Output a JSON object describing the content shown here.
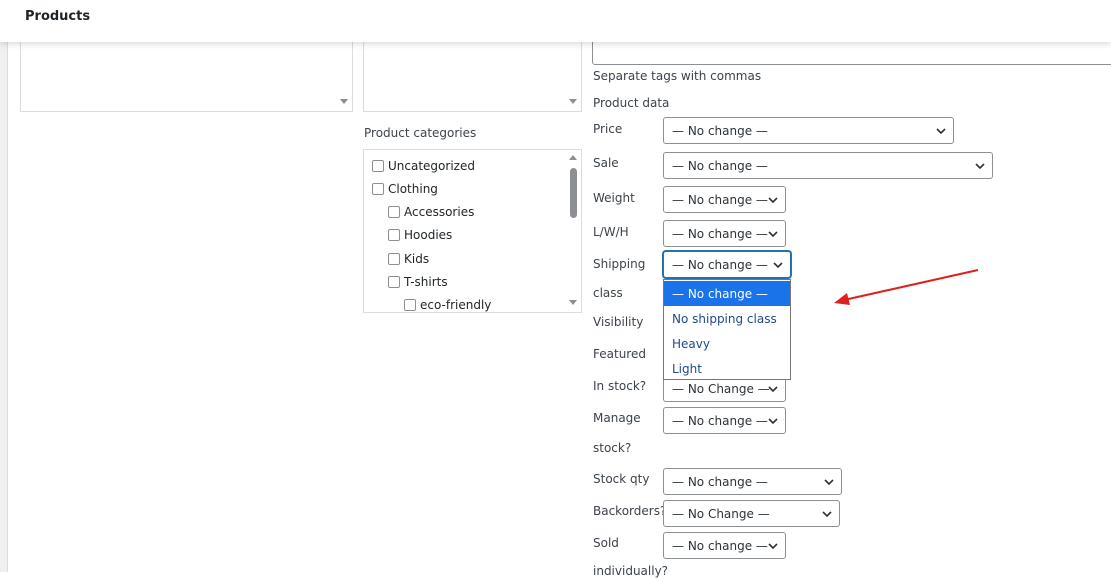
{
  "header": {
    "title": "Products"
  },
  "tags": {
    "hint": "Separate tags with commas"
  },
  "categories": {
    "label": "Product categories",
    "items": [
      {
        "label": "Uncategorized"
      },
      {
        "label": "Clothing"
      },
      {
        "label": "Accessories"
      },
      {
        "label": "Hoodies"
      },
      {
        "label": "Kids"
      },
      {
        "label": "T-shirts"
      },
      {
        "label": "eco-friendly"
      }
    ]
  },
  "product_data": {
    "heading": "Product data",
    "fields": {
      "price": {
        "label": "Price",
        "value": "— No change —"
      },
      "sale": {
        "label": "Sale",
        "value": "— No change —"
      },
      "weight": {
        "label": "Weight",
        "value": "— No change —"
      },
      "lwh": {
        "label": "L/W/H",
        "value": "— No change —"
      },
      "shipping": {
        "label_1": "Shipping",
        "label_2": "class",
        "value": "— No change —"
      },
      "visibility": {
        "label": "Visibility"
      },
      "featured": {
        "label": "Featured"
      },
      "in_stock": {
        "label": "In stock?",
        "value": "— No Change —"
      },
      "manage_stock": {
        "label_1": "Manage",
        "label_2": "stock?",
        "value": "— No change —"
      },
      "stock_qty": {
        "label": "Stock qty",
        "value": "— No change —"
      },
      "backorders": {
        "label": "Backorders?",
        "value": "— No Change —"
      },
      "sold_individually": {
        "label_1": "Sold",
        "label_2": "individually?",
        "value": "— No change —"
      }
    },
    "shipping_dropdown": {
      "options": [
        {
          "label": "— No change —"
        },
        {
          "label": "No shipping class"
        },
        {
          "label": "Heavy"
        },
        {
          "label": "Light"
        }
      ],
      "selected_index": 0
    }
  },
  "colors": {
    "accent": "#2271b1",
    "selected_option": "#1a73e8",
    "annotation_arrow": "#e02020"
  }
}
